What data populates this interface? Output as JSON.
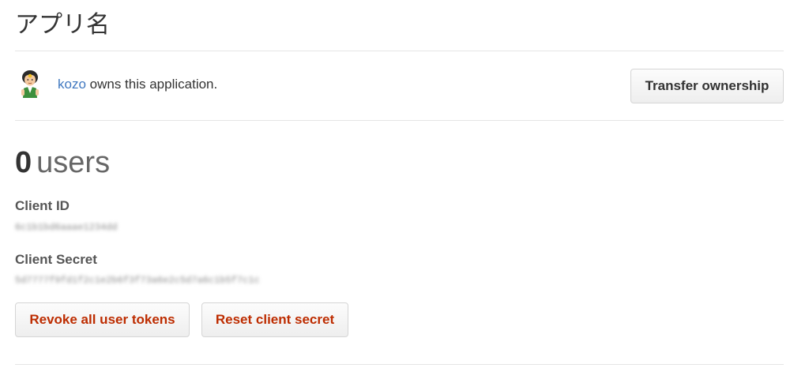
{
  "app": {
    "title": "アプリ名"
  },
  "owner": {
    "username": "kozo",
    "suffix_text": " owns this application.",
    "transfer_button_label": "Transfer ownership"
  },
  "stats": {
    "users_count": "0",
    "users_label": "users"
  },
  "credentials": {
    "client_id_label": "Client ID",
    "client_id_value": "6c1b1bd6aaae1234dd",
    "client_secret_label": "Client Secret",
    "client_secret_value": "5d7777f9fd1f2c1e2b6f3f73a6e2c5d7a6c1b5f7c1c"
  },
  "actions": {
    "revoke_label": "Revoke all user tokens",
    "reset_label": "Reset client secret"
  },
  "colors": {
    "link": "#4078c0",
    "danger_text": "#bd2c00",
    "divider": "#e5e5e5"
  }
}
